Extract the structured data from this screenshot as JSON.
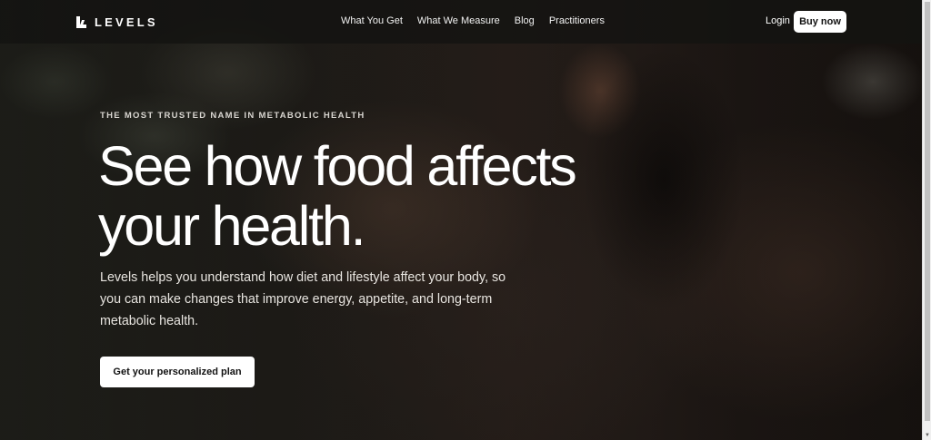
{
  "brand": {
    "name": "LEVELS",
    "logo_icon": "levels-logo-icon"
  },
  "nav": {
    "links": [
      {
        "label": "What You Get"
      },
      {
        "label": "What We Measure"
      },
      {
        "label": "Blog"
      },
      {
        "label": "Practitioners"
      }
    ],
    "login_label": "Login",
    "buy_label": "Buy now"
  },
  "hero": {
    "eyebrow": "THE MOST TRUSTED NAME IN METABOLIC HEALTH",
    "headline_line1": "See how food affects",
    "headline_line2": "your health.",
    "subtext": "Levels helps you understand how diet and lifestyle affect your body, so you can make changes that improve energy, appetite, and long-term metabolic health.",
    "cta_label": "Get your personalized plan"
  },
  "colors": {
    "nav_background": "#141311",
    "button_background": "#ffffff",
    "button_text": "#111111",
    "text_primary": "#ffffff"
  }
}
